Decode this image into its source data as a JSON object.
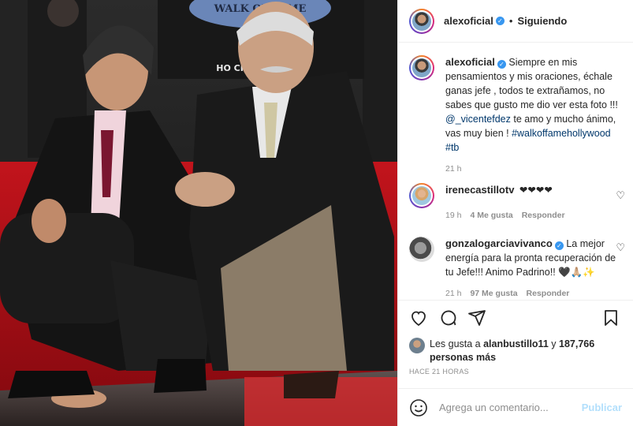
{
  "post": {
    "author": "alexoficial",
    "follow_status": "Siguiendo",
    "separator": "•",
    "caption_parts": [
      "Siempre en mis pensamientos y mis oraciones, échale ganas jefe , todos te extrañamos, no sabes que gusto me dio ver esta foto !!! ",
      "@_vicentefdez",
      " te amo y mucho ánimo, vas muy bien ! ",
      "#walkoffamehollywood",
      " ",
      "#tb"
    ],
    "caption_time": "21 h",
    "photo_sign_top": "WALK OF FAME",
    "photo_sign_bottom": "HO    CHAMBER        RCE"
  },
  "comments": [
    {
      "user": "irenecastillotv",
      "text": "❤❤❤❤",
      "time": "19 h",
      "likes": "4 Me gusta",
      "reply": "Responder",
      "verified": false
    },
    {
      "user": "gonzalogarciavivanco",
      "text": "La mejor energía para la pronta recuperación de tu Jefe!!! Animo Padrino!! 🖤🙏🏼✨",
      "time": "21 h",
      "likes": "97 Me gusta",
      "reply": "Responder",
      "verified": true
    }
  ],
  "likes": {
    "prefix": "Les gusta a ",
    "user": "alanbustillo11",
    "middle": " y",
    "count": "187,766 personas más"
  },
  "timestamp": "HACE 21 HORAS",
  "composer": {
    "placeholder": "Agrega un comentario...",
    "publish": "Publicar"
  },
  "icons": {
    "like": "heart-icon",
    "comment": "comment-icon",
    "share": "share-icon",
    "save": "bookmark-icon",
    "emoji": "emoji-icon"
  },
  "colors": {
    "link": "#00376b",
    "verified": "#3897f0",
    "publish_disabled": "#b2dffc",
    "muted": "#8e8e8e"
  }
}
